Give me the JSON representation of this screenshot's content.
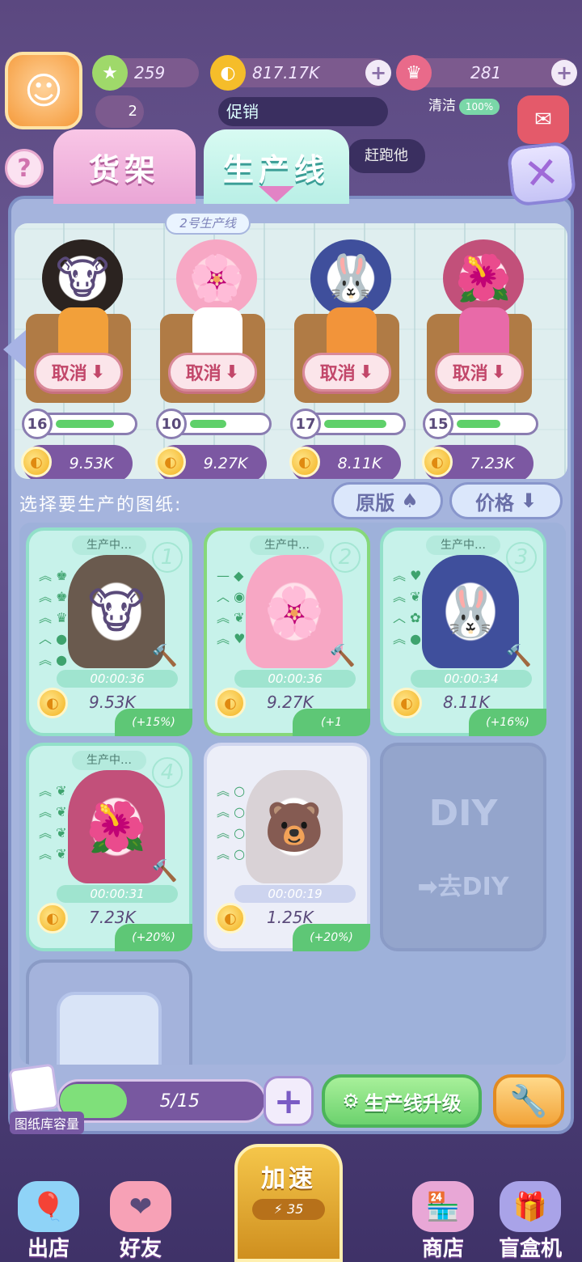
{
  "top": {
    "stars": "259",
    "coins": "817.17K",
    "crowns": "281",
    "promo": "促销",
    "clean_label": "清洁",
    "clean_value": "100%",
    "run_hint": "赶跑他",
    "heart_count": "2"
  },
  "tabs": {
    "shelf": "货架",
    "line": "生产线"
  },
  "stage": {
    "line_tag": "2号生产线",
    "workers": [
      {
        "level": "16",
        "level_fraction": 0.8,
        "price": "9.53K",
        "cancel": "取消"
      },
      {
        "level": "10",
        "level_fraction": 0.5,
        "price": "9.27K",
        "cancel": "取消"
      },
      {
        "level": "17",
        "level_fraction": 0.85,
        "price": "8.11K",
        "cancel": "取消"
      },
      {
        "level": "15",
        "level_fraction": 0.6,
        "price": "7.23K",
        "cancel": "取消"
      }
    ]
  },
  "select": {
    "label": "选择要生产的图纸:",
    "sort_original": "原版",
    "sort_price": "价格"
  },
  "cards": [
    {
      "status": "生产中…",
      "index": "1",
      "timer": "00:00:36",
      "price": "9.53K",
      "bonus": "(+15%)"
    },
    {
      "status": "生产中…",
      "index": "2",
      "timer": "00:00:36",
      "price": "9.27K",
      "bonus": "(+1"
    },
    {
      "status": "生产中…",
      "index": "3",
      "timer": "00:00:34",
      "price": "8.11K",
      "bonus": "(+16%)"
    },
    {
      "status": "生产中…",
      "index": "4",
      "timer": "00:00:31",
      "price": "7.23K",
      "bonus": "(+20%)"
    },
    {
      "status": "",
      "index": "",
      "timer": "00:00:19",
      "price": "1.25K",
      "bonus": "(+20%)"
    }
  ],
  "diy": {
    "title": "DIY",
    "go": "去DIY"
  },
  "bottom": {
    "capacity": "5/15",
    "capacity_label": "图纸库容量",
    "upgrade": "生产线升级"
  },
  "nav": {
    "speed": "加速",
    "speed_count": "35",
    "out": "出店",
    "friends": "好友",
    "shop": "商店",
    "blindbox": "盲盒机"
  }
}
